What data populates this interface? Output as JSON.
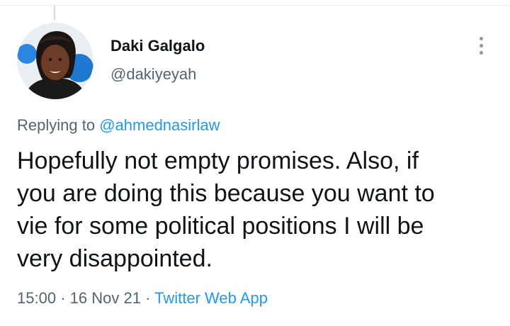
{
  "tweet": {
    "author_name": "Daki Galgalo",
    "author_handle": "@dakiyeyah",
    "replying_to_prefix": "Replying to",
    "replying_to_handle": "@ahmednasirlaw",
    "text_lines": [
      "Hopefully not empty promises. Also, if",
      "you are doing this because you want to",
      "vie for some political positions I will be",
      "very disappointed."
    ],
    "time": "15:00",
    "date": "16 Nov 21",
    "separator": "·",
    "source": "Twitter Web App"
  },
  "icons": {
    "more": "more-options-icon",
    "avatar": "profile-photo"
  },
  "colors": {
    "text_primary": "#0f1419",
    "text_secondary": "#536471",
    "link": "#1d9bf0",
    "thread_line": "#cfd9de"
  }
}
